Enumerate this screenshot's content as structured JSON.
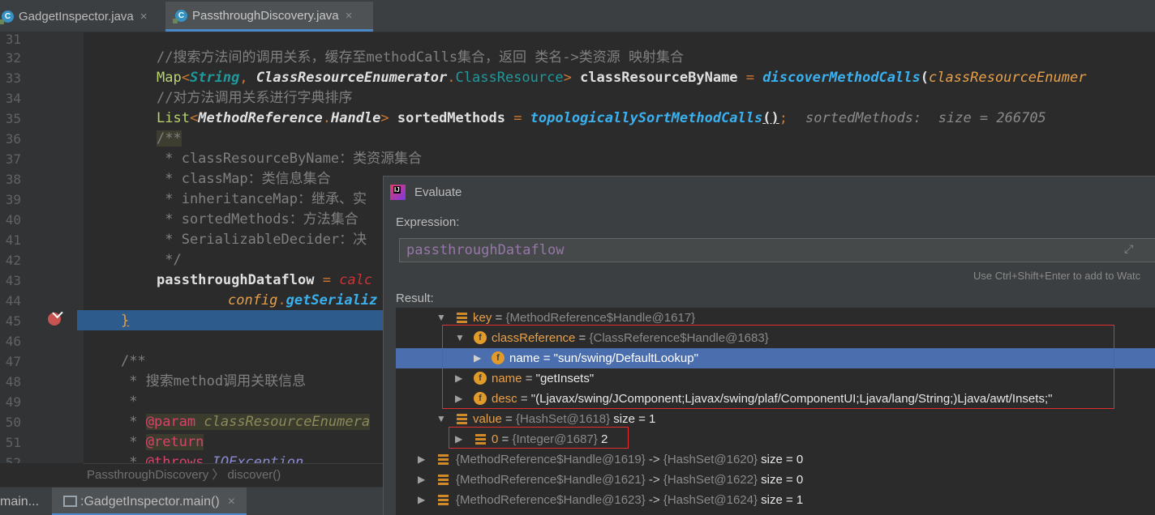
{
  "tabs": [
    {
      "label": "GadgetInspector.java",
      "close": "×"
    },
    {
      "label": "PassthroughDiscovery.java",
      "close": "×"
    }
  ],
  "editor": {
    "lines": [
      {
        "n": "31"
      },
      {
        "n": "32"
      },
      {
        "n": "33"
      },
      {
        "n": "34"
      },
      {
        "n": "35"
      },
      {
        "n": "36"
      },
      {
        "n": "37"
      },
      {
        "n": "38"
      },
      {
        "n": "39"
      },
      {
        "n": "40"
      },
      {
        "n": "41"
      },
      {
        "n": "42"
      },
      {
        "n": "43"
      },
      {
        "n": "44"
      },
      {
        "n": "45"
      },
      {
        "n": "46"
      },
      {
        "n": "47"
      },
      {
        "n": "48"
      },
      {
        "n": "49"
      },
      {
        "n": "50"
      },
      {
        "n": "51"
      },
      {
        "n": "52"
      }
    ],
    "code": {
      "l32": "//搜索方法间的调用关系，缓存至methodCalls集合，返回 类名->类资源 映射集合",
      "l33_type": "Map",
      "l33_lt": "<",
      "l33_string": "String",
      "l33_comma": ", ",
      "l33_cre": "ClassResourceEnumerator",
      "l33_dot": ".",
      "l33_cr": "ClassResource",
      "l33_gt": ">",
      "l33_var": " classResourceByName",
      "l33_eq": " = ",
      "l33_fn": "discoverMethodCalls",
      "l33_paren": "(",
      "l33_arg": "classResourceEnumer",
      "l34": "//对方法调用关系进行字典排序",
      "l35_type": "List",
      "l35_lt": "<",
      "l35_mr": "MethodReference",
      "l35_dot": ".",
      "l35_h": "Handle",
      "l35_gt": ">",
      "l35_var": " sortedMethods",
      "l35_eq": " = ",
      "l35_fn": "topologicallySortMethodCalls",
      "l35_call": "()",
      "l35_semi": ";",
      "l35_inline": "sortedMethods:  size = 266705",
      "l36": "/**",
      "l37": " * classResourceByName：类资源集合",
      "l38": " * classMap：类信息集合",
      "l39": " * inheritanceMap：继承、实",
      "l40": " * sortedMethods：方法集合",
      "l41": " * SerializableDecider：决",
      "l42": " */",
      "l43_var": "passthroughDataflow",
      "l43_eq": " = ",
      "l43_fn": "calc",
      "l44_cfg": "config",
      "l44_dot": ".",
      "l44_fn": "getSerializ",
      "l45": "}",
      "l47": "/**",
      "l48": " * 搜索method调用关联信息",
      "l49": " *",
      "l50_star": " * ",
      "l50_tag": "@param",
      "l50_arg": " classResourceEnumera",
      "l51_star": " * ",
      "l51_tag": "@return",
      "l52_star": " * ",
      "l52_tag": "@throws",
      "l52_arg": " IOException"
    }
  },
  "breadcrumb": {
    "cls": "PassthroughDiscovery",
    "sep": "〉",
    "method": "discover()"
  },
  "bottom": {
    "left": "main...",
    "item": ":GadgetInspector.main()",
    "close": "×"
  },
  "evaluate": {
    "title": "Evaluate",
    "expression_label": "Expression:",
    "expression": "passthroughDataflow",
    "hint": "Use Ctrl+Shift+Enter to add to Watc",
    "result_label": "Result:",
    "nodes": [
      {
        "name": "key",
        "eq": " = ",
        "val": "{MethodReference$Handle@1617}"
      },
      {
        "name": "classReference",
        "eq": " = ",
        "val": "{ClassReference$Handle@1683}"
      },
      {
        "name": "name",
        "eq": " = ",
        "val": "\"sun/swing/DefaultLookup\""
      },
      {
        "name": "name",
        "eq": " = ",
        "val": "\"getInsets\""
      },
      {
        "name": "desc",
        "eq": " = ",
        "val": "\"(Ljavax/swing/JComponent;Ljavax/swing/plaf/ComponentUI;Ljava/lang/String;)Ljava/awt/Insets;\""
      },
      {
        "name": "value",
        "eq": " = ",
        "val": "{HashSet@1618}",
        "extra": " size = 1"
      },
      {
        "name": "0",
        "eq": " = ",
        "val": "{Integer@1687}",
        "extra": " 2"
      },
      {
        "name": "{MethodReference$Handle@1619}",
        "eq": " -> ",
        "val": "{HashSet@1620}",
        "extra": " size = 0"
      },
      {
        "name": "{MethodReference$Handle@1621}",
        "eq": " -> ",
        "val": "{HashSet@1622}",
        "extra": " size = 0"
      },
      {
        "name": "{MethodReference$Handle@1623}",
        "eq": " -> ",
        "val": "{HashSet@1624}",
        "extra": " size = 1"
      }
    ]
  }
}
